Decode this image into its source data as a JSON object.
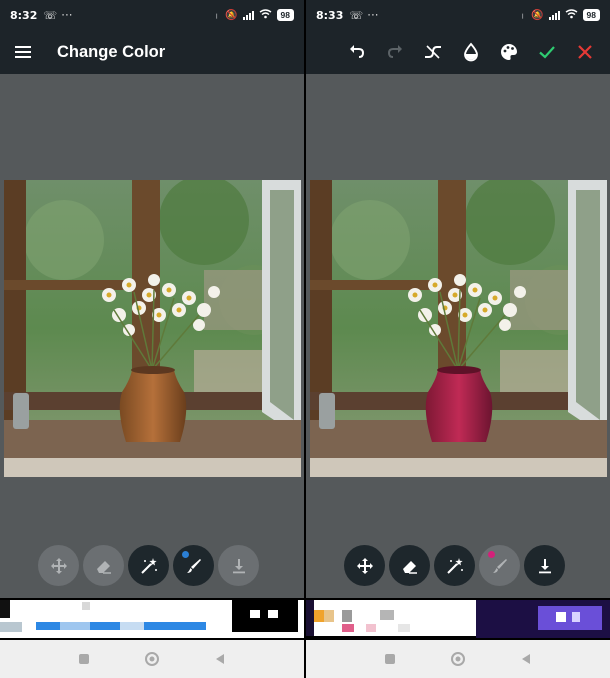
{
  "left": {
    "status_time": "8:32",
    "battery": "98",
    "title": "Change Color",
    "vase_color": "#b5703a",
    "tools": [
      {
        "name": "move-tool",
        "icon": "move-icon",
        "enabled": false
      },
      {
        "name": "eraser-tool",
        "icon": "eraser-icon",
        "enabled": false
      },
      {
        "name": "magic-wand-tool",
        "icon": "magic-wand-icon",
        "enabled": true
      },
      {
        "name": "brush-tool",
        "icon": "brush-icon",
        "enabled": true,
        "dot_color": "#2b7fd4"
      },
      {
        "name": "save-tool",
        "icon": "download-icon",
        "enabled": false
      }
    ]
  },
  "right": {
    "status_time": "8:33",
    "battery": "98",
    "vase_color": "#c02a55",
    "toolbar": [
      {
        "name": "undo-button",
        "icon": "undo-icon",
        "enabled": true
      },
      {
        "name": "redo-button",
        "icon": "redo-icon",
        "enabled": false
      },
      {
        "name": "curve-button",
        "icon": "curve-icon",
        "enabled": true
      },
      {
        "name": "opacity-button",
        "icon": "drop-icon",
        "enabled": true
      },
      {
        "name": "palette-button",
        "icon": "palette-icon",
        "enabled": true
      },
      {
        "name": "apply-button",
        "icon": "check-icon",
        "enabled": true,
        "color": "#2ecc71"
      },
      {
        "name": "cancel-button",
        "icon": "close-icon",
        "enabled": true,
        "color": "#e53935"
      }
    ],
    "tools": [
      {
        "name": "move-tool",
        "icon": "move-icon",
        "enabled": true
      },
      {
        "name": "eraser-tool",
        "icon": "eraser-icon",
        "enabled": true
      },
      {
        "name": "magic-wand-tool",
        "icon": "magic-wand-icon",
        "enabled": true
      },
      {
        "name": "brush-tool",
        "icon": "brush-icon",
        "enabled": false,
        "dot_color": "#d4217a"
      },
      {
        "name": "save-tool",
        "icon": "download-icon",
        "enabled": true
      }
    ]
  },
  "colors": {
    "bar": "#1d2429",
    "canvas": "#55595b",
    "tool_active": "#1e272c",
    "tool_inactive": "#6b6f72"
  }
}
